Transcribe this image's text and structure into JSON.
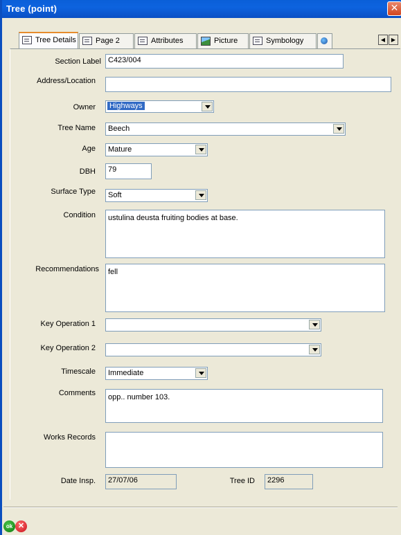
{
  "window": {
    "title": "Tree (point)"
  },
  "tabs": [
    {
      "label": "Tree Details",
      "icon": "form-icon"
    },
    {
      "label": "Page 2",
      "icon": "form-icon"
    },
    {
      "label": "Attributes",
      "icon": "grid-icon"
    },
    {
      "label": "Picture",
      "icon": "picture-icon"
    },
    {
      "label": "Symbology",
      "icon": "list-icon"
    },
    {
      "label": "",
      "icon": "globe-icon"
    }
  ],
  "form": {
    "section_label": {
      "label": "Section Label",
      "value": "C423/004"
    },
    "address": {
      "label": "Address/Location",
      "value": ""
    },
    "owner": {
      "label": "Owner",
      "value": "Highways"
    },
    "tree_name": {
      "label": "Tree Name",
      "value": "Beech"
    },
    "age": {
      "label": "Age",
      "value": "Mature"
    },
    "dbh": {
      "label": "DBH",
      "value": "79"
    },
    "surface_type": {
      "label": "Surface Type",
      "value": "Soft"
    },
    "condition": {
      "label": "Condition",
      "value": "ustulina deusta fruiting bodies at base."
    },
    "recommendations": {
      "label": "Recommendations",
      "value": "fell"
    },
    "key_op_1": {
      "label": "Key Operation 1",
      "value": ""
    },
    "key_op_2": {
      "label": "Key Operation 2",
      "value": ""
    },
    "timescale": {
      "label": "Timescale",
      "value": "Immediate"
    },
    "comments": {
      "label": "Comments",
      "value": "opp.. number 103."
    },
    "works_records": {
      "label": "Works Records",
      "value": ""
    },
    "date_insp": {
      "label": "Date Insp.",
      "value": "27/07/06"
    },
    "tree_id": {
      "label": "Tree ID",
      "value": "2296"
    }
  },
  "footer": {
    "ok_label": "ok",
    "cancel_label": "✕"
  },
  "colors": {
    "title_bar": "#0a5fd8",
    "selection": "#316ac5",
    "close_button": "#d2451f",
    "ok_button": "#0c7a0c",
    "cancel_button": "#c8101a"
  }
}
